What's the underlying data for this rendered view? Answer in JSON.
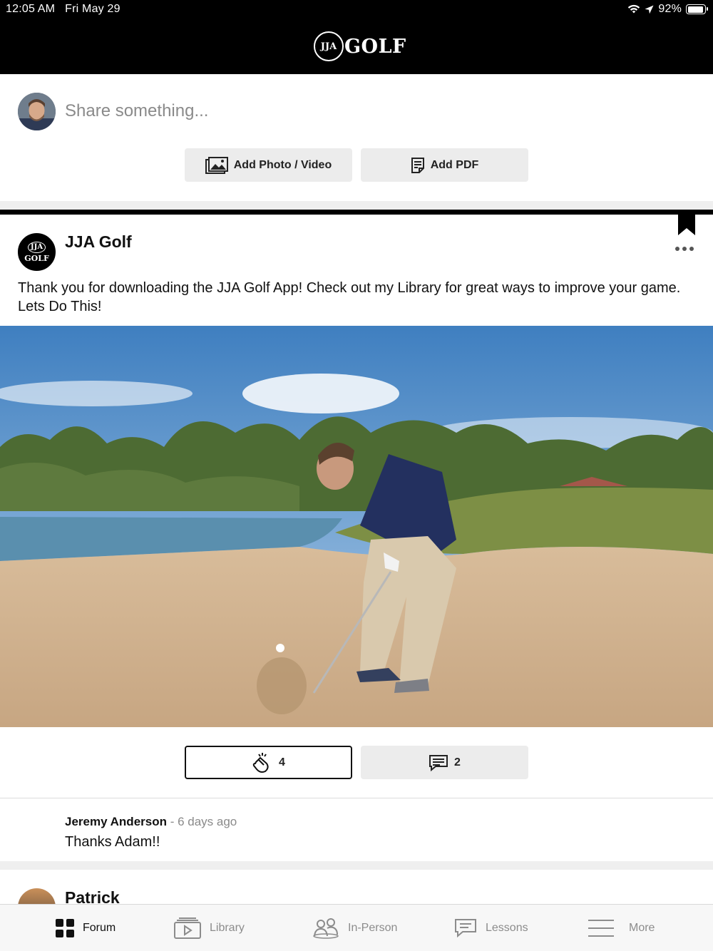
{
  "status_bar": {
    "time": "12:05 AM",
    "date": "Fri May 29",
    "battery_level": 92,
    "battery_text": "92%"
  },
  "header": {
    "logo_badge": "JJA",
    "logo_text": "GOLF"
  },
  "composer": {
    "placeholder": "Share something...",
    "add_photo_label": "Add Photo / Video",
    "add_pdf_label": "Add PDF"
  },
  "post": {
    "author": "JJA Golf",
    "avatar_badge_top": "JJA",
    "avatar_badge_bottom": "GOLF",
    "text": "Thank you for downloading the JJA Golf App! Check out my Library for great ways to improve your game. Lets Do This!",
    "claps": "4",
    "comments": "2"
  },
  "comment": {
    "author": "Jeremy Anderson",
    "time": " - 6 days ago",
    "text": "Thanks Adam!!"
  },
  "next_post": {
    "author": "Patrick"
  },
  "tabs": [
    {
      "label": "Forum",
      "icon": "grid-icon",
      "active": true
    },
    {
      "label": "Library",
      "icon": "video-library-icon",
      "active": false
    },
    {
      "label": "In-Person",
      "icon": "people-icon",
      "active": false
    },
    {
      "label": "Lessons",
      "icon": "chat-icon",
      "active": false
    },
    {
      "label": "More",
      "icon": "menu-icon",
      "active": false
    }
  ],
  "colors": {
    "header_bg": "#000000",
    "button_bg": "#ececec",
    "muted_text": "#8a8a8a"
  }
}
